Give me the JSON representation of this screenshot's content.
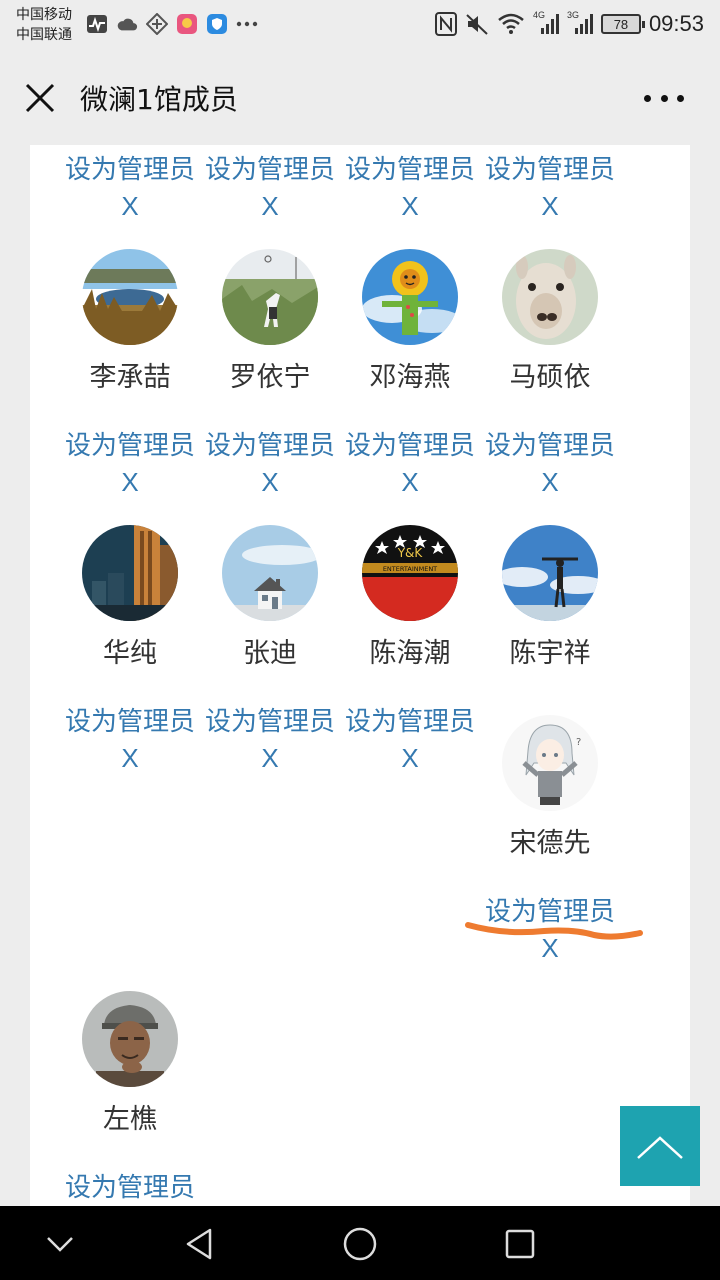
{
  "status_bar": {
    "carrier1": "中国移动",
    "carrier2": "中国联通",
    "signal1": "4G",
    "signal2": "3G",
    "battery": "78",
    "time": "09:53"
  },
  "header": {
    "title": "微澜1馆成员"
  },
  "labels": {
    "set_admin": "设为管理员",
    "remove": "X"
  },
  "members": [
    {
      "name": "李承喆"
    },
    {
      "name": "罗依宁"
    },
    {
      "name": "邓海燕"
    },
    {
      "name": "马硕依"
    },
    {
      "name": "华纯"
    },
    {
      "name": "张迪"
    },
    {
      "name": "陈海潮"
    },
    {
      "name": "陈宇祥"
    },
    {
      "name": "宋德先"
    },
    {
      "name": "左樵"
    }
  ],
  "avatar_texts": {
    "yk_logo": "Y&K",
    "yk_sub": "ENTERTAINMENT"
  },
  "colors": {
    "link": "#3579b0",
    "accent_back_top": "#1ea3b0",
    "highlight_mark": "#ee7b30"
  }
}
